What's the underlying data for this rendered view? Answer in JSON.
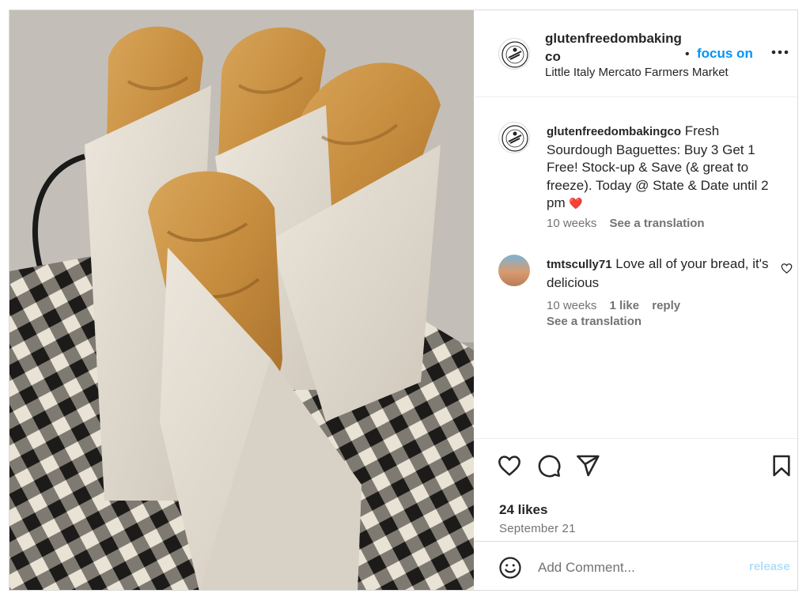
{
  "post": {
    "image_alt": "baguettes-in-paper-on-checkered-cloth"
  },
  "header": {
    "username": "glutenfreedombakingco",
    "dot": "•",
    "follow_label": "focus on",
    "location": "Little Italy Mercato Farmers Market",
    "more_icon": "more-horizontal-icon"
  },
  "caption": {
    "username": "glutenfreedombakingco",
    "text": "Fresh Sourdough Baguettes: Buy 3 Get 1 Free! Stock-up & Save (& great to freeze). Today @ State & Date until 2 pm",
    "emoji": "❤️",
    "age": "10 weeks",
    "translate_label": "See a translation"
  },
  "comment": {
    "username": "tmtscully71",
    "text": "Love all of your bread, it's delicious",
    "age": "10 weeks",
    "likes": "1 like",
    "reply_label": "reply",
    "translate_label": "See a translation"
  },
  "actions": {
    "likes": "24 likes",
    "date": "September 21"
  },
  "add_comment": {
    "placeholder": "Add Comment...",
    "post_label": "release"
  },
  "colors": {
    "link_blue": "#0095f6",
    "post_disabled": "#b2dffc",
    "secondary_text": "#737373",
    "border": "#dbdbdb"
  }
}
